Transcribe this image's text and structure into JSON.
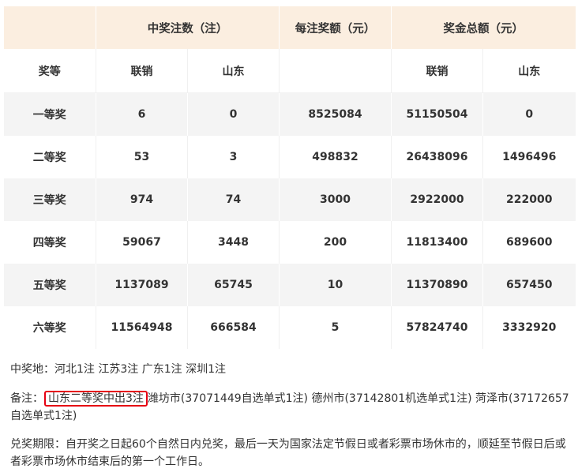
{
  "table": {
    "header": {
      "col_winners": "中奖注数（注）",
      "col_per_ticket": "每注奖额（元）",
      "col_total": "奖金总额（元）"
    },
    "subheader": {
      "level": "奖等",
      "winners_union": "联销",
      "winners_shandong": "山东",
      "total_union": "联销",
      "total_shandong": "山东"
    },
    "rows": [
      {
        "level": "一等奖",
        "winners_union": "6",
        "winners_shandong": "0",
        "per_ticket": "8525084",
        "total_union": "51150504",
        "total_shandong": "0"
      },
      {
        "level": "二等奖",
        "winners_union": "53",
        "winners_shandong": "3",
        "per_ticket": "498832",
        "total_union": "26438096",
        "total_shandong": "1496496"
      },
      {
        "level": "三等奖",
        "winners_union": "974",
        "winners_shandong": "74",
        "per_ticket": "3000",
        "total_union": "2922000",
        "total_shandong": "222000"
      },
      {
        "level": "四等奖",
        "winners_union": "59067",
        "winners_shandong": "3448",
        "per_ticket": "200",
        "total_union": "11813400",
        "total_shandong": "689600"
      },
      {
        "level": "五等奖",
        "winners_union": "1137089",
        "winners_shandong": "65745",
        "per_ticket": "10",
        "total_union": "11370890",
        "total_shandong": "657450"
      },
      {
        "level": "六等奖",
        "winners_union": "11564948",
        "winners_shandong": "666584",
        "per_ticket": "5",
        "total_union": "57824740",
        "total_shandong": "3332920"
      }
    ]
  },
  "notes": {
    "winning_places": "中奖地：河北1注 江苏3注 广东1注 深圳1注",
    "remark_label": "备注：",
    "remark_highlight": "山东二等奖中出3注",
    "remark_rest": "潍坊市(37071449自选单式1注) 德州市(37142801机选单式1注) 菏泽市(37172657自选单式1注)",
    "redeem": "兑奖期限：自开奖之日起60个自然日内兑奖，最后一天为国家法定节假日或者彩票市场休市的，顺延至节假日后或者彩票市场休市结束后的第一个工作日。"
  },
  "colors": {
    "header_bg": "#fbeee0",
    "stripe_bg": "#f4f4f4",
    "highlight_border": "#e60012"
  }
}
